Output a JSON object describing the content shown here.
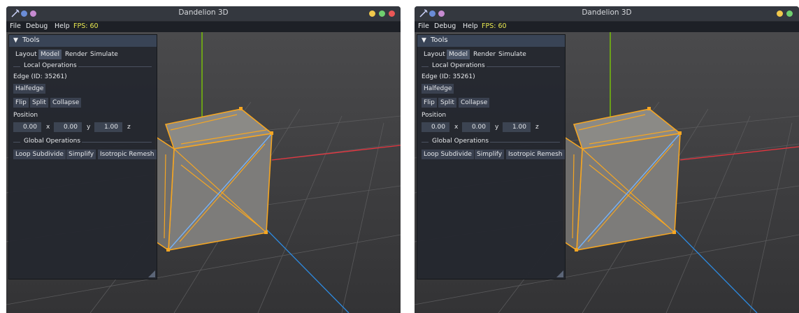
{
  "app": {
    "title": "Dandelion 3D",
    "menu": [
      "File",
      "Debug",
      "Help"
    ],
    "fps_text": "FPS: 60"
  },
  "colors": {
    "accent_yellow": "#e8e850",
    "selection_orange": "#f5a623",
    "axis_x": "#e8353f",
    "axis_y": "#7fd000",
    "axis_z": "#2d8ae0"
  },
  "icons": [
    "dandelion-logo-icon",
    "window-close-dot",
    "window-minimize-dot",
    "window-maximize-dot"
  ],
  "panel": {
    "title": "Tools",
    "tabs": [
      "Layout",
      "Model",
      "Render",
      "Simulate"
    ],
    "active_tab": "Model",
    "local_ops_label": "Local Operations",
    "edge_label": "Edge (ID: 35261)",
    "halfedge_button": "Halfedge",
    "edge_buttons": [
      "Flip",
      "Split",
      "Collapse"
    ],
    "position_label": "Position",
    "position": [
      {
        "value": "0.00",
        "axis": "x"
      },
      {
        "value": "0.00",
        "axis": "y"
      },
      {
        "value": "1.00",
        "axis": "z"
      }
    ],
    "global_ops_label": "Global Operations",
    "global_buttons": [
      "Loop Subdivide",
      "Simplify",
      "Isotropic Remesh"
    ]
  }
}
